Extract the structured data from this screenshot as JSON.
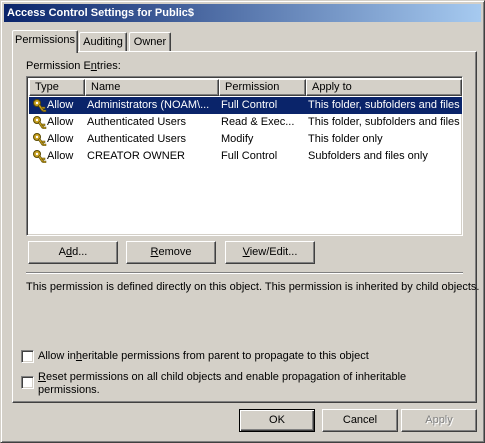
{
  "window": {
    "title": "Access Control Settings for Public$"
  },
  "tabs": [
    {
      "label": "Permissions",
      "active": true
    },
    {
      "label": "Auditing",
      "active": false
    },
    {
      "label": "Owner",
      "active": false
    }
  ],
  "permissions": {
    "entries_label_pre": "Permission E",
    "entries_label_u": "n",
    "entries_label_post": "tries:",
    "columns": [
      "Type",
      "Name",
      "Permission",
      "Apply to"
    ],
    "rows": [
      {
        "type": "Allow",
        "name": "Administrators (NOAM\\...",
        "permission": "Full Control",
        "apply_to": "This folder, subfolders and files",
        "selected": true,
        "icon": "key-icon"
      },
      {
        "type": "Allow",
        "name": "Authenticated Users",
        "permission": "Read & Exec...",
        "apply_to": "This folder, subfolders and files",
        "selected": false,
        "icon": "key-icon"
      },
      {
        "type": "Allow",
        "name": "Authenticated Users",
        "permission": "Modify",
        "apply_to": "This folder only",
        "selected": false,
        "icon": "key-icon"
      },
      {
        "type": "Allow",
        "name": "CREATOR OWNER",
        "permission": "Full Control",
        "apply_to": "Subfolders and files only",
        "selected": false,
        "icon": "key-icon"
      }
    ],
    "buttons": {
      "add_pre": "A",
      "add_u": "d",
      "add_post": "d...",
      "remove_pre": "",
      "remove_u": "R",
      "remove_post": "emove",
      "view_pre": "",
      "view_u": "V",
      "view_post": "iew/Edit..."
    },
    "description": "This permission is defined directly on this object. This permission is inherited by child objects.",
    "checkbox_inherit": {
      "pre": "Allow in",
      "u": "h",
      "post": "eritable permissions from parent to propagate to this object",
      "checked": false
    },
    "checkbox_reset": {
      "pre": "",
      "u": "R",
      "post": "eset permissions on all child objects and enable propagation of inheritable",
      "line2": "permissions.",
      "checked": false
    }
  },
  "dialog_buttons": {
    "ok": "OK",
    "cancel": "Cancel",
    "apply": "Apply"
  }
}
